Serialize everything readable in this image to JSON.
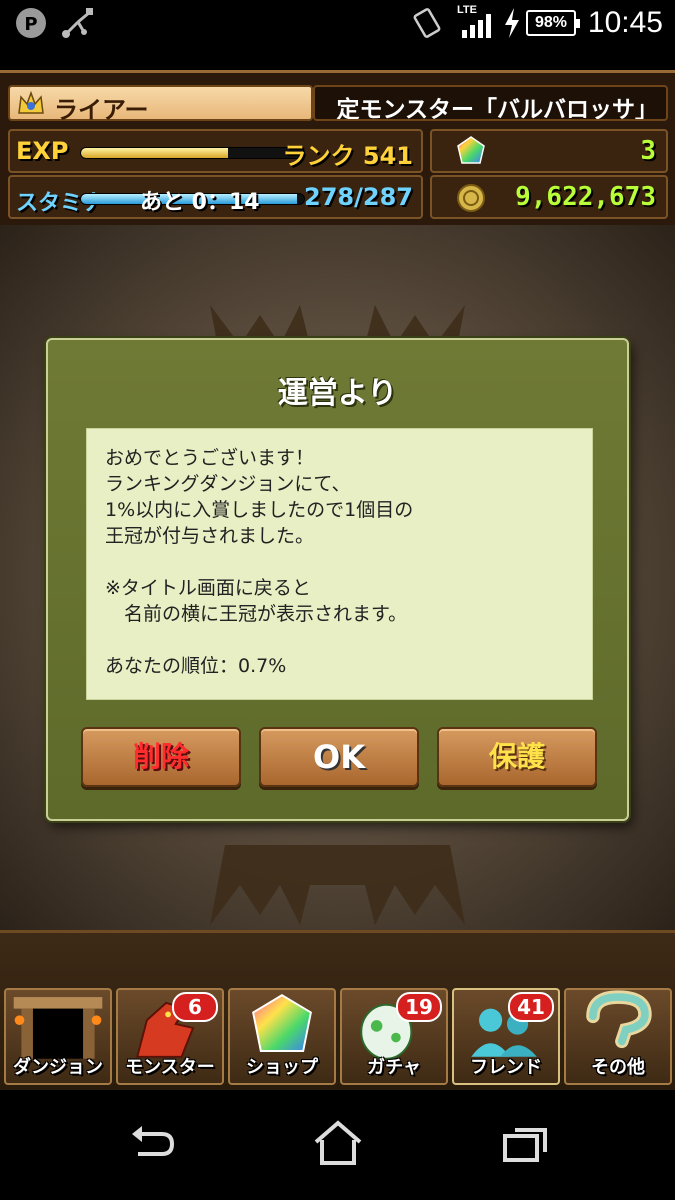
{
  "status_bar": {
    "time": "10:45",
    "battery": "98%",
    "network": "LTE",
    "icons": [
      "pad-app-icon",
      "usb-icon",
      "vibrate-icon",
      "signal-icon",
      "charging-icon"
    ]
  },
  "header": {
    "player_name": "ライアー",
    "ticker": "定モンスター「バルバロッサ」",
    "exp_label": "EXP",
    "exp_progress": 0.66,
    "rank": "ランク 541",
    "stamina_label": "スタミナ",
    "stamina_timer": "あと 0：14",
    "stamina_progress": 0.97,
    "stamina_value": "278/287",
    "magic_stones": "3",
    "coins": "9,622,673"
  },
  "dialog": {
    "title": "運営より",
    "lines": [
      "おめでとうございます！",
      "ランキングダンジョンにて、",
      "1%以内に入賞しましたので1個目の",
      "王冠が付与されました。"
    ],
    "note_lines": [
      "※タイトル画面に戻ると",
      "　名前の横に王冠が表示されます。"
    ],
    "rank_line": "あなたの順位：0.7%",
    "buttons": {
      "delete": "削除",
      "ok": "OK",
      "protect": "保護"
    }
  },
  "menu": {
    "items": [
      {
        "label": "ダンジョン",
        "badge": ""
      },
      {
        "label": "モンスター",
        "badge": "6"
      },
      {
        "label": "ショップ",
        "badge": ""
      },
      {
        "label": "ガチャ",
        "badge": "19"
      },
      {
        "label": "フレンド",
        "badge": "41"
      },
      {
        "label": "その他",
        "badge": ""
      }
    ]
  },
  "colors": {
    "dialog_bg": "#6f7a35",
    "text_panel": "#e9efc4",
    "button": "#c88a4f",
    "delete_text": "#ff2d2d",
    "protect_text": "#ffe14a"
  }
}
